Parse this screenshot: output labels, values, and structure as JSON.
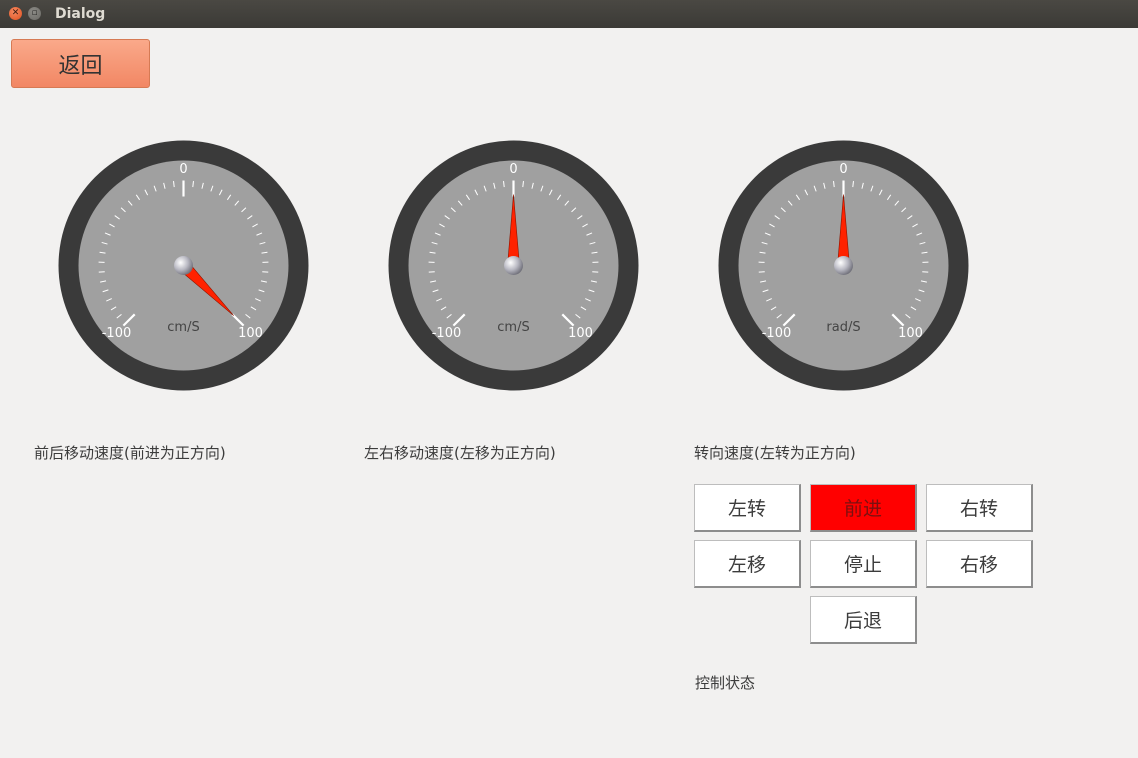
{
  "window": {
    "title": "Dialog"
  },
  "toolbar": {
    "back_label": "返回"
  },
  "gauges": [
    {
      "value": 100,
      "min": -100,
      "max": 100,
      "unit": "cm/S",
      "min_label": "-100",
      "zero_label": "0",
      "max_label": "100",
      "caption": "前后移动速度(前进为正方向)"
    },
    {
      "value": 0,
      "min": -100,
      "max": 100,
      "unit": "cm/S",
      "min_label": "-100",
      "zero_label": "0",
      "max_label": "100",
      "caption": "左右移动速度(左移为正方向)"
    },
    {
      "value": 0,
      "min": -100,
      "max": 100,
      "unit": "rad/S",
      "min_label": "-100",
      "zero_label": "0",
      "max_label": "100",
      "caption": "转向速度(左转为正方向)"
    }
  ],
  "controls": {
    "turn_left": "左转",
    "forward": "前进",
    "turn_right": "右转",
    "move_left": "左移",
    "stop": "停止",
    "move_right": "右移",
    "backward": "后退",
    "active": "forward",
    "active_color": "#ff0000"
  },
  "status": {
    "label": "控制状态"
  },
  "colors": {
    "gauge_rim": "#3a3a3a",
    "gauge_face": "#a0a0a0",
    "needle": "#ff2200",
    "back_button": "#f59a78"
  }
}
